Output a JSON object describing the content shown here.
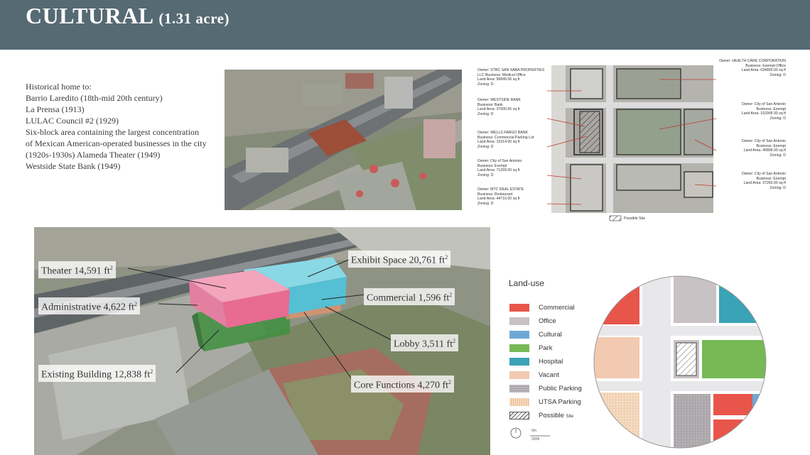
{
  "header": {
    "title": "CULTURAL",
    "acreage": "(1.31 acre)"
  },
  "intro": {
    "heading": "Historical home to:",
    "lines": [
      "Barrio Laredito (18th-mid 20th century)",
      "La Prensa (1913)",
      "LULAC Council #2 (1929)",
      "Six-block area containing the largest concentration",
      "of Mexican American-operated businesses in the city",
      "(1920s-1930s) Alameda Theater (1949)",
      "Westside State Bank (1949)"
    ]
  },
  "parcel_map": {
    "left_labels": [
      [
        "Owner: STRC SAN SABA PROPERTIES",
        "LLC Business: Medical Office",
        "Land Area: 56849.56 sq ft",
        "Zoning: D"
      ],
      [
        "Owner: WESTSIDE BANK",
        "Business: Bank",
        "Land Area: 37000.65 sq ft",
        "Zoning: D"
      ],
      [
        "Owner: WELLS FARGO BANK",
        "Business: Commercial Parking Lot",
        "Land Area: 15314.00 sq ft",
        "Zoning: D"
      ],
      [
        "Owner: City of San Antonio",
        "Business: Exempt",
        "Land Area: 71269.00 sq ft",
        "Zoning: D"
      ],
      [
        "Owner: MTC REAL ESTATE",
        "Business: Restaurant",
        "Land Area: 44710.00 sq ft",
        "Zoning: D"
      ]
    ],
    "right_labels": [
      [
        "Owner: HEALTH CARE CORPORATION",
        "Business: Exempt-Office",
        "Land Area: 634805.00 sq ft",
        "Zoning: D"
      ],
      [
        "Owner: City of San Antonio",
        "Business: Exempt",
        "Land Area: 152906.00 sq ft",
        "Zoning: D"
      ],
      [
        "Owner: City of San Antonio",
        "Business: Exempt",
        "Land Area: 45806.00 sq ft",
        "Zoning: D"
      ],
      [
        "Owner: City of San Antonio",
        "Business: Exempt",
        "Land Area: 37260.00 sq ft",
        "Zoning: D"
      ]
    ],
    "legend": "Possible Site"
  },
  "massing": {
    "callouts": [
      {
        "label": "Theater 14,591 ft",
        "sup": "2"
      },
      {
        "label": "Administrative 4,622 ft",
        "sup": "2"
      },
      {
        "label": "Existing Building 12,838 ft",
        "sup": "2"
      },
      {
        "label": "Exhibit Space 20,761 ft",
        "sup": "2"
      },
      {
        "label": "Commercial 1,596 ft",
        "sup": "2"
      },
      {
        "label": "Lobby 3,511 ft",
        "sup": "2"
      },
      {
        "label": "Core Functions 4,270 ft",
        "sup": "2"
      }
    ]
  },
  "landuse": {
    "title": "Land-use",
    "legend": [
      {
        "label": "Commercial",
        "color": "#e8554b"
      },
      {
        "label": "Office",
        "color": "#c8c2c4"
      },
      {
        "label": "Cultural",
        "color": "#6fa8d6"
      },
      {
        "label": "Park",
        "color": "#76b955"
      },
      {
        "label": "Hospital",
        "color": "#3aa3b5"
      },
      {
        "label": "Vacant",
        "color": "#f2c9b1"
      },
      {
        "label": "Public Parking",
        "color": "#a8a4a8"
      },
      {
        "label": "UTSA Parking",
        "color": "#f3d6b8"
      },
      {
        "label": "Possible",
        "suffix": "Site",
        "color": "#ffffff"
      }
    ],
    "scale": {
      "top": "0m",
      "bottom": "200ft"
    }
  }
}
